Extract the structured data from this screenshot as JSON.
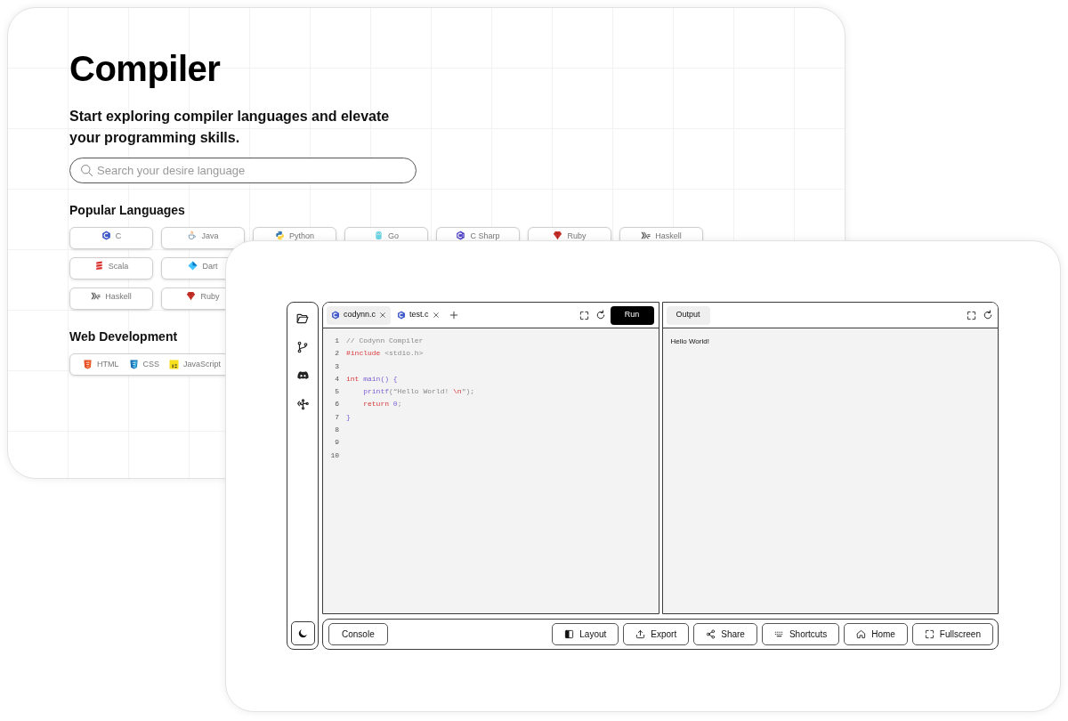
{
  "catalog": {
    "title": "Compiler",
    "subtitle": "Start exploring compiler languages and elevate your programming skills.",
    "search": {
      "placeholder": "Search your desire language"
    },
    "sections": [
      {
        "heading": "Popular Languages",
        "kind": "chip_rows",
        "rows": [
          [
            {
              "label": "C"
            },
            {
              "label": "Java"
            },
            {
              "label": "Python"
            },
            {
              "label": "Go"
            },
            {
              "label": "C Sharp"
            },
            {
              "label": "Ruby"
            },
            {
              "label": "Haskell"
            }
          ],
          [
            {
              "label": "Scala"
            },
            {
              "label": "Dart"
            }
          ],
          [
            {
              "label": "Haskell"
            },
            {
              "label": "Ruby"
            }
          ]
        ]
      },
      {
        "heading": "Web Development",
        "kind": "chip_group",
        "items": [
          {
            "label": "HTML"
          },
          {
            "label": "CSS"
          },
          {
            "label": "JavaScript"
          }
        ]
      }
    ]
  },
  "ide": {
    "editor": {
      "tabs": [
        {
          "label": "codynn.c",
          "selected": true
        },
        {
          "label": "test.c",
          "selected": false
        }
      ],
      "run_button": "Run",
      "lines": [
        {
          "number": "1",
          "tokens": [
            {
              "kind": "comment",
              "text": "// Codynn Compiler"
            }
          ]
        },
        {
          "number": "2",
          "tokens": [
            {
              "kind": "directive",
              "text": "#include"
            },
            {
              "kind": "header",
              "text": " <stdio.h>"
            }
          ]
        },
        {
          "number": "3"
        },
        {
          "number": "4",
          "tokens": [
            {
              "kind": "keyword",
              "text": "int"
            },
            {
              "kind": "function",
              "text": " main() {"
            }
          ]
        },
        {
          "number": "5",
          "tokens": [
            {
              "kind": "function",
              "text": "    printf"
            },
            {
              "kind": "string",
              "text": "(“Hello World! "
            },
            {
              "kind": "escape",
              "text": "\\n"
            },
            {
              "kind": "string",
              "text": "\");"
            }
          ]
        },
        {
          "number": "6",
          "tokens": [
            {
              "kind": "keyword",
              "text": "    return"
            },
            {
              "kind": "number",
              "text": " 0"
            },
            {
              "kind": "punct",
              "text": ";"
            }
          ]
        },
        {
          "number": "7",
          "tokens": [
            {
              "kind": "function",
              "text": "}"
            }
          ]
        },
        {
          "number": "8"
        },
        {
          "number": "9"
        },
        {
          "number": "10"
        }
      ]
    },
    "output": {
      "tabs": [
        {
          "label": "Output",
          "selected": true
        }
      ],
      "text": "Hello World!"
    },
    "toolbar": {
      "console_button": "Console",
      "buttons": [
        "Layout",
        "Export",
        "Share",
        "Shortcuts",
        "Home",
        "Fullscreen"
      ]
    }
  }
}
